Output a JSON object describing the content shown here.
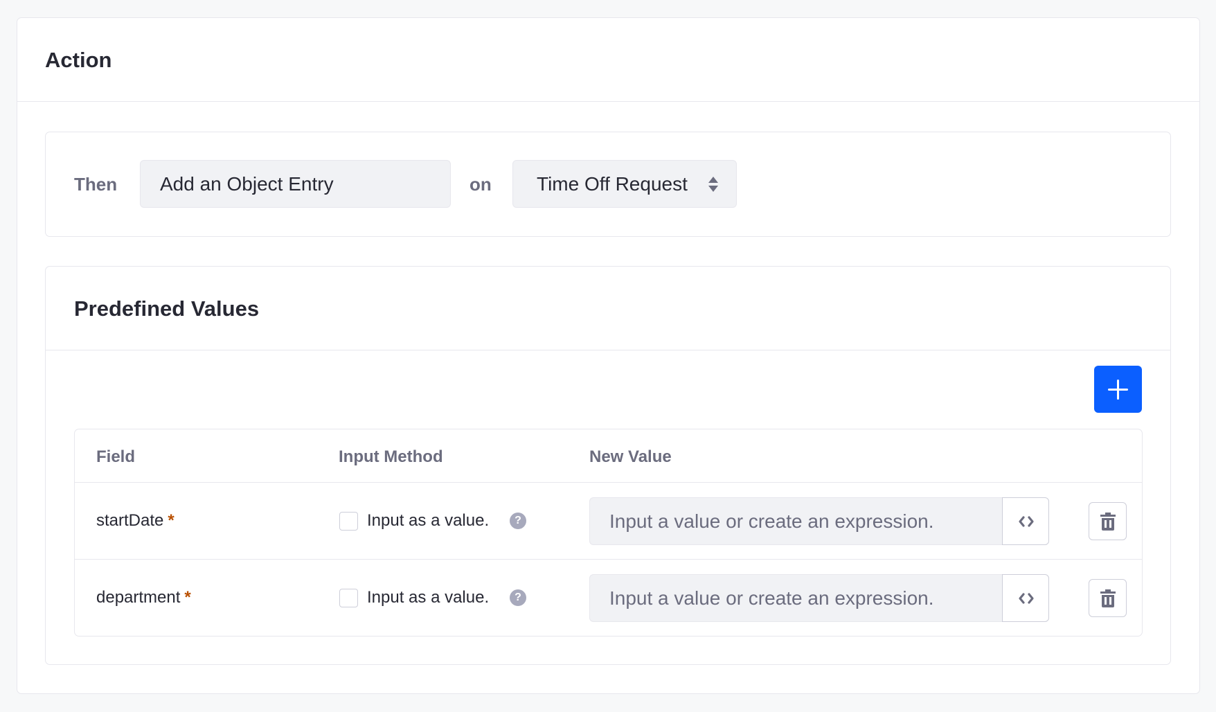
{
  "section": {
    "title": "Action"
  },
  "action": {
    "then_label": "Then",
    "action_value": "Add an Object Entry",
    "on_label": "on",
    "object_value": "Time Off Request"
  },
  "predefined": {
    "title": "Predefined Values",
    "add_icon": "plus-icon",
    "columns": [
      "Field",
      "Input Method",
      "New Value"
    ],
    "rows": [
      {
        "field": "startDate",
        "required": "*",
        "checkbox_label": "Input as a value.",
        "help": "?",
        "placeholder": "Input a value or create an expression.",
        "checked": false
      },
      {
        "field": "department",
        "required": "*",
        "checkbox_label": "Input as a value.",
        "help": "?",
        "placeholder": "Input a value or create an expression.",
        "checked": false
      }
    ]
  },
  "colors": {
    "primary": "#0b5fff",
    "required": "#b95000",
    "label": "#6b6c7e",
    "text": "#272833"
  }
}
